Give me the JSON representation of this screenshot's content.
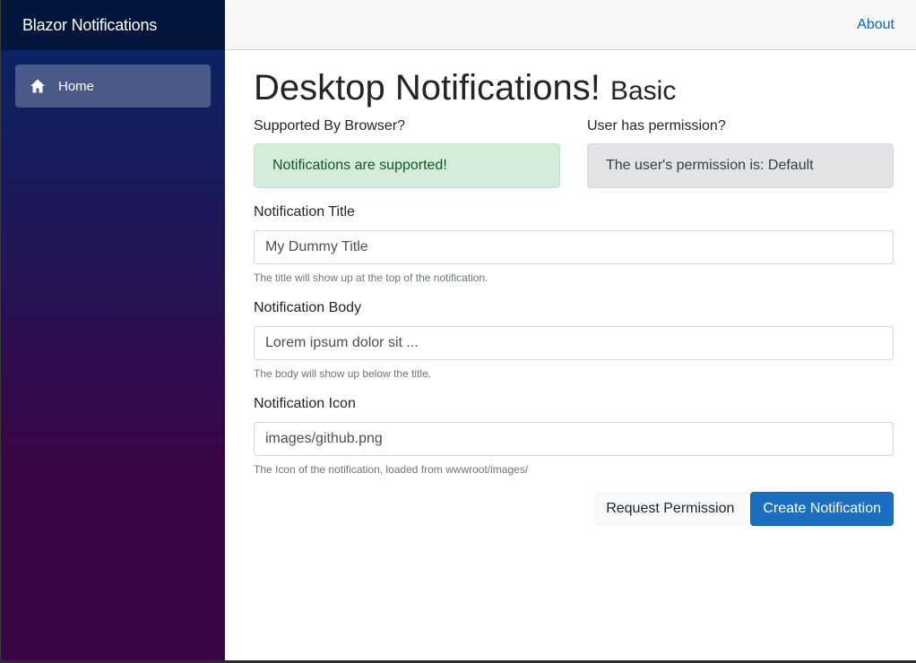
{
  "sidebar": {
    "brand": "Blazor Notifications",
    "items": [
      {
        "label": "Home",
        "icon": "home-icon",
        "active": true
      }
    ]
  },
  "header": {
    "about_label": "About"
  },
  "page": {
    "title": "Desktop Notifications!",
    "subtitle": "Basic"
  },
  "status": {
    "supported_label": "Supported By Browser?",
    "supported_message": "Notifications are supported!",
    "permission_label": "User has permission?",
    "permission_message": "The user's permission is: Default"
  },
  "form": {
    "title": {
      "label": "Notification Title",
      "value": "My Dummy Title",
      "help": "The title will show up at the top of the notification."
    },
    "body": {
      "label": "Notification Body",
      "value": "Lorem ipsum dolor sit ...",
      "help": "The body will show up below the title."
    },
    "icon": {
      "label": "Notification Icon",
      "value": "images/github.png",
      "help": "The Icon of the notification, loaded from wwwroot/images/"
    }
  },
  "actions": {
    "request_permission": "Request Permission",
    "create_notification": "Create Notification"
  },
  "colors": {
    "sidebar_top": "#052767",
    "sidebar_bottom": "#3a0647",
    "primary": "#1b6ec2",
    "success_bg": "#d4edda",
    "secondary_bg": "#e2e3e5"
  }
}
